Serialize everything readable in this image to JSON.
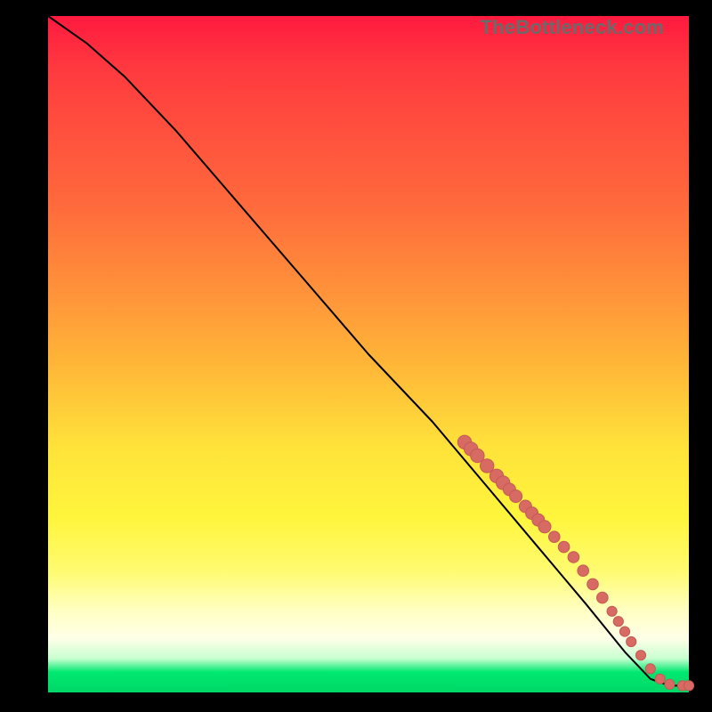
{
  "watermark": "TheBottleneck.com",
  "chart_data": {
    "type": "line",
    "title": "",
    "xlabel": "",
    "ylabel": "",
    "xlim": [
      0,
      100
    ],
    "ylim": [
      0,
      100
    ],
    "grid": false,
    "legend": null,
    "curve": [
      {
        "x": 0,
        "y": 100
      },
      {
        "x": 6,
        "y": 96
      },
      {
        "x": 12,
        "y": 91
      },
      {
        "x": 20,
        "y": 83
      },
      {
        "x": 30,
        "y": 72
      },
      {
        "x": 40,
        "y": 61
      },
      {
        "x": 50,
        "y": 50
      },
      {
        "x": 60,
        "y": 40
      },
      {
        "x": 68,
        "y": 31
      },
      {
        "x": 76,
        "y": 22
      },
      {
        "x": 84,
        "y": 13
      },
      {
        "x": 90,
        "y": 6
      },
      {
        "x": 94,
        "y": 2
      },
      {
        "x": 97,
        "y": 1
      },
      {
        "x": 100,
        "y": 1
      }
    ],
    "points": [
      {
        "x": 65,
        "y": 37,
        "r": 1.1
      },
      {
        "x": 66,
        "y": 36,
        "r": 1.1
      },
      {
        "x": 67,
        "y": 35,
        "r": 1.1
      },
      {
        "x": 68.5,
        "y": 33.5,
        "r": 1.1
      },
      {
        "x": 70,
        "y": 32,
        "r": 1.1
      },
      {
        "x": 71,
        "y": 31,
        "r": 1.1
      },
      {
        "x": 72,
        "y": 30,
        "r": 1.0
      },
      {
        "x": 73,
        "y": 29,
        "r": 1.0
      },
      {
        "x": 74.5,
        "y": 27.5,
        "r": 1.0
      },
      {
        "x": 75.5,
        "y": 26.5,
        "r": 1.0
      },
      {
        "x": 76.5,
        "y": 25.5,
        "r": 1.0
      },
      {
        "x": 77.5,
        "y": 24.5,
        "r": 1.0
      },
      {
        "x": 79,
        "y": 23,
        "r": 0.9
      },
      {
        "x": 80.5,
        "y": 21.5,
        "r": 0.9
      },
      {
        "x": 82,
        "y": 20,
        "r": 0.9
      },
      {
        "x": 83.5,
        "y": 18,
        "r": 0.9
      },
      {
        "x": 85,
        "y": 16,
        "r": 0.9
      },
      {
        "x": 86.5,
        "y": 14,
        "r": 0.9
      },
      {
        "x": 88,
        "y": 12,
        "r": 0.8
      },
      {
        "x": 89,
        "y": 10.5,
        "r": 0.8
      },
      {
        "x": 90,
        "y": 9,
        "r": 0.8
      },
      {
        "x": 91,
        "y": 7.5,
        "r": 0.8
      },
      {
        "x": 92.5,
        "y": 5.5,
        "r": 0.8
      },
      {
        "x": 94,
        "y": 3.5,
        "r": 0.8
      },
      {
        "x": 95.5,
        "y": 2,
        "r": 0.8
      },
      {
        "x": 97,
        "y": 1.2,
        "r": 0.8
      },
      {
        "x": 99,
        "y": 1,
        "r": 0.8
      },
      {
        "x": 100,
        "y": 1,
        "r": 0.8
      }
    ],
    "colors": {
      "curve": "#000000",
      "points": "#d76a63",
      "gradient_top": "#ff1a3f",
      "gradient_mid": "#ffe33a",
      "gradient_bottom": "#00d766"
    }
  }
}
